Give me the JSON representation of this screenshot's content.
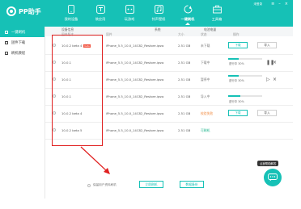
{
  "app": {
    "title": "PP助手"
  },
  "nav": [
    {
      "label": "我的设备",
      "icon": "device-icon"
    },
    {
      "label": "装应用",
      "icon": "apps-icon"
    },
    {
      "label": "玩游戏",
      "icon": "game-icon"
    },
    {
      "label": "铃声壁纸",
      "icon": "music-icon"
    },
    {
      "label": "一键刷机",
      "icon": "flash-icon"
    },
    {
      "label": "工具箱",
      "icon": "toolbox-icon"
    }
  ],
  "window": {
    "user": "未登录"
  },
  "sidebar": [
    {
      "label": "一键刷机",
      "active": true
    },
    {
      "label": "固件下载",
      "active": false
    },
    {
      "label": "刷机教程",
      "active": false
    }
  ],
  "table": {
    "group_headers": [
      "设备信息",
      "系统",
      "电池电量"
    ],
    "columns": [
      "固件版本",
      "固件",
      "大小",
      "状态",
      "操作"
    ],
    "rows": [
      {
        "version": "10.0.2 beta 4",
        "badge": "beta",
        "file": "iPhone_5.5_10.0_14C82_Restore.ipsw",
        "size": "2.51 GB",
        "status": "未下载",
        "status_class": "st-gray",
        "action": "buttons"
      },
      {
        "version": "10.0.1",
        "file": "iPhone_5.5_10.0_14C82_Restore.ipsw",
        "size": "2.51 GB",
        "status": "下载中",
        "status_class": "st-gray",
        "action": "progress",
        "progress_label": "进行中 30%",
        "progress": 0.3
      },
      {
        "version": "10.0.1",
        "file": "iPhone_5.5_10.0_14C82_Restore.ipsw",
        "size": "2.51 GB",
        "status": "暂停中",
        "status_class": "st-gray",
        "action": "paused",
        "progress_label": "进行中 30%",
        "progress": 0.3
      },
      {
        "version": "10.0.1",
        "file": "iPhone_5.5_10.0_14C82_Restore.ipsw",
        "size": "2.51 GB",
        "status": "导入中",
        "status_class": "st-gray",
        "action": "importing",
        "progress_label": "进行中 30%",
        "progress": 0.35
      },
      {
        "version": "10.0.2 beta 4",
        "file": "iPhone_5.5_10.0_14C82_Restore.ipsw",
        "size": "2.51 GB",
        "status": "校验失败",
        "status_class": "st-orange",
        "action": "buttons"
      },
      {
        "version": "10.0.2 beta 5",
        "file": "iPhone_5.5_10.0_14C82_Restore.ipsw",
        "size": "2.51 GB",
        "status": "可刷机",
        "status_class": "st-green",
        "action": "none"
      }
    ]
  },
  "actions": {
    "download": "下载",
    "import": "导入"
  },
  "bottom": {
    "checkbox_label": "保留用户资料刷机",
    "primary_button": "立即刷机",
    "secondary_button": "数据备份"
  },
  "help": {
    "bubble": "点我帮助解答"
  },
  "colors": {
    "brand": "#16c1b6",
    "highlight": "#e02020",
    "warning": "#f0883c",
    "success": "#1ab38a"
  }
}
